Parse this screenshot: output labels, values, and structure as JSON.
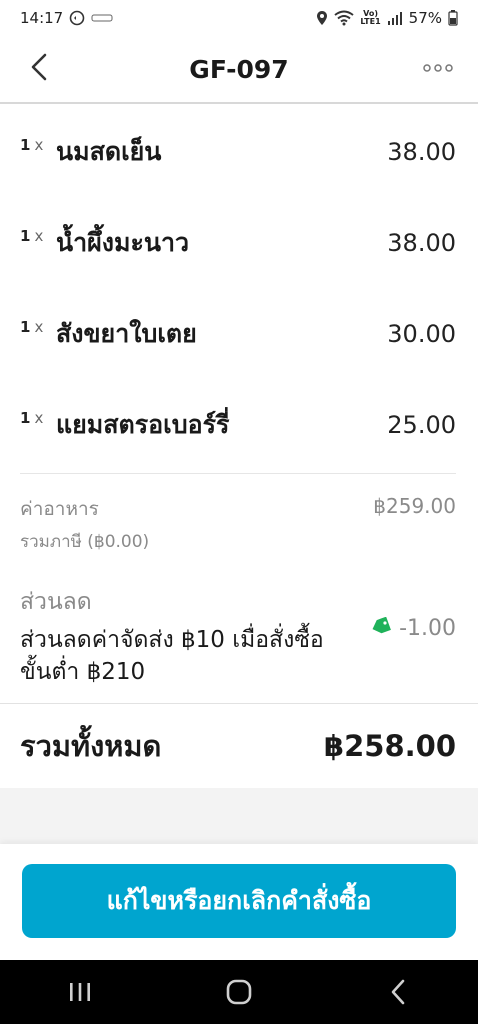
{
  "status_bar": {
    "time": "14:17",
    "battery": "57%",
    "network": "Vo)\nLTE1"
  },
  "header": {
    "title": "GF-097"
  },
  "items": [
    {
      "qty": "1",
      "x": "x",
      "name": "นมสดเย็น",
      "price": "38.00"
    },
    {
      "qty": "1",
      "x": "x",
      "name": "น้ำผึ้งมะนาว",
      "price": "38.00"
    },
    {
      "qty": "1",
      "x": "x",
      "name": "สังขยาใบเตย",
      "price": "30.00"
    },
    {
      "qty": "1",
      "x": "x",
      "name": "แยมสตรอเบอร์รี่",
      "price": "25.00"
    }
  ],
  "food": {
    "label": "ค่าอาหาร",
    "tax_label": "รวมภาษี (฿0.00)",
    "amount": "฿259.00"
  },
  "discount": {
    "title": "ส่วนลด",
    "desc": "ส่วนลดค่าจัดส่ง ฿10 เมื่อสั่งซื้อขั้นต่ำ ฿210",
    "amount": "-1.00",
    "tag_color": "#1fb25a"
  },
  "total": {
    "label": "รวมทั้งหมด",
    "amount": "฿258.00"
  },
  "cta": {
    "label": "แก้ไขหรือยกเลิกคำสั่งซื้อ",
    "color": "#00a5cf"
  }
}
